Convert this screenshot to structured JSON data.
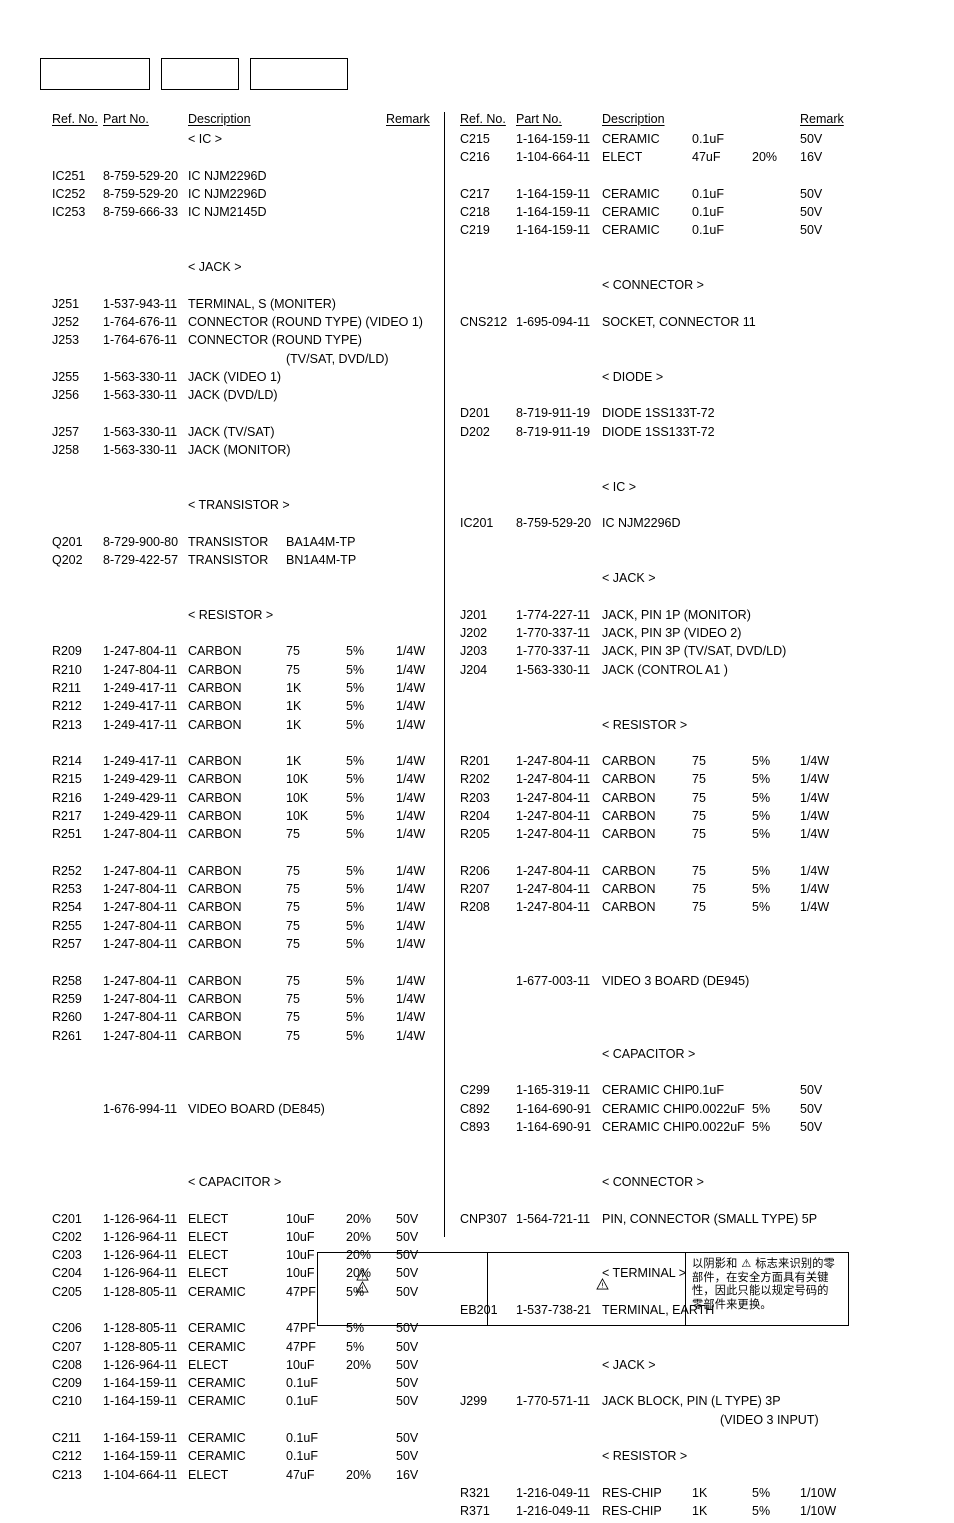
{
  "top_boxes": [
    {
      "label": ""
    },
    {
      "label": ""
    },
    {
      "label": ""
    }
  ],
  "headers": {
    "ref_no": "Ref. No.",
    "part_no": "Part No.",
    "description": "Description",
    "remark": "Remark"
  },
  "left_column": [
    {
      "kind": "section",
      "desc": "< IC >"
    },
    {
      "kind": "gap"
    },
    {
      "kind": "row",
      "ref": "IC251",
      "part": "8-759-529-20",
      "desc": "IC   NJM2296D"
    },
    {
      "kind": "row",
      "ref": "IC252",
      "part": "8-759-529-20",
      "desc": "IC   NJM2296D"
    },
    {
      "kind": "row",
      "ref": "IC253",
      "part": "8-759-666-33",
      "desc": "IC   NJM2145D"
    },
    {
      "kind": "gap2"
    },
    {
      "kind": "section",
      "desc": "< JACK >"
    },
    {
      "kind": "gap"
    },
    {
      "kind": "row",
      "ref": "J251",
      "part": "1-537-943-11",
      "desc": "TERMINAL, S (MONITER)"
    },
    {
      "kind": "row",
      "ref": "J252",
      "part": "1-764-676-11",
      "desc": "CONNECTOR (ROUND TYPE) (VIDEO 1)"
    },
    {
      "kind": "row",
      "ref": "J253",
      "part": "1-764-676-11",
      "desc": "CONNECTOR (ROUND TYPE)"
    },
    {
      "kind": "cont",
      "cont": "(TV/SAT, DVD/LD)"
    },
    {
      "kind": "row",
      "ref": "J255",
      "part": "1-563-330-11",
      "desc": "JACK (VIDEO 1)"
    },
    {
      "kind": "row",
      "ref": "J256",
      "part": "1-563-330-11",
      "desc": "JACK (DVD/LD)"
    },
    {
      "kind": "gap"
    },
    {
      "kind": "row",
      "ref": "J257",
      "part": "1-563-330-11",
      "desc": "JACK (TV/SAT)"
    },
    {
      "kind": "row",
      "ref": "J258",
      "part": "1-563-330-11",
      "desc": "JACK (MONITOR)"
    },
    {
      "kind": "gap2"
    },
    {
      "kind": "section",
      "desc": "< TRANSISTOR >"
    },
    {
      "kind": "gap"
    },
    {
      "kind": "row",
      "ref": "Q201",
      "part": "8-729-900-80",
      "desc": "TRANSISTOR",
      "val": "BA1A4M-TP"
    },
    {
      "kind": "row",
      "ref": "Q202",
      "part": "8-729-422-57",
      "desc": "TRANSISTOR",
      "val": "BN1A4M-TP"
    },
    {
      "kind": "gap2"
    },
    {
      "kind": "section",
      "desc": "< RESISTOR >"
    },
    {
      "kind": "gap"
    },
    {
      "kind": "row",
      "ref": "R209",
      "part": "1-247-804-11",
      "desc": "CARBON",
      "val": "75",
      "tol": "5%",
      "rat": "1/4W"
    },
    {
      "kind": "row",
      "ref": "R210",
      "part": "1-247-804-11",
      "desc": "CARBON",
      "val": "75",
      "tol": "5%",
      "rat": "1/4W"
    },
    {
      "kind": "row",
      "ref": "R211",
      "part": "1-249-417-11",
      "desc": "CARBON",
      "val": "1K",
      "tol": "5%",
      "rat": "1/4W"
    },
    {
      "kind": "row",
      "ref": "R212",
      "part": "1-249-417-11",
      "desc": "CARBON",
      "val": "1K",
      "tol": "5%",
      "rat": "1/4W"
    },
    {
      "kind": "row",
      "ref": "R213",
      "part": "1-249-417-11",
      "desc": "CARBON",
      "val": "1K",
      "tol": "5%",
      "rat": "1/4W"
    },
    {
      "kind": "gap"
    },
    {
      "kind": "row",
      "ref": "R214",
      "part": "1-249-417-11",
      "desc": "CARBON",
      "val": "1K",
      "tol": "5%",
      "rat": "1/4W"
    },
    {
      "kind": "row",
      "ref": "R215",
      "part": "1-249-429-11",
      "desc": "CARBON",
      "val": "10K",
      "tol": "5%",
      "rat": "1/4W"
    },
    {
      "kind": "row",
      "ref": "R216",
      "part": "1-249-429-11",
      "desc": "CARBON",
      "val": "10K",
      "tol": "5%",
      "rat": "1/4W"
    },
    {
      "kind": "row",
      "ref": "R217",
      "part": "1-249-429-11",
      "desc": "CARBON",
      "val": "10K",
      "tol": "5%",
      "rat": "1/4W"
    },
    {
      "kind": "row",
      "ref": "R251",
      "part": "1-247-804-11",
      "desc": "CARBON",
      "val": "75",
      "tol": "5%",
      "rat": "1/4W"
    },
    {
      "kind": "gap"
    },
    {
      "kind": "row",
      "ref": "R252",
      "part": "1-247-804-11",
      "desc": "CARBON",
      "val": "75",
      "tol": "5%",
      "rat": "1/4W"
    },
    {
      "kind": "row",
      "ref": "R253",
      "part": "1-247-804-11",
      "desc": "CARBON",
      "val": "75",
      "tol": "5%",
      "rat": "1/4W"
    },
    {
      "kind": "row",
      "ref": "R254",
      "part": "1-247-804-11",
      "desc": "CARBON",
      "val": "75",
      "tol": "5%",
      "rat": "1/4W"
    },
    {
      "kind": "row",
      "ref": "R255",
      "part": "1-247-804-11",
      "desc": "CARBON",
      "val": "75",
      "tol": "5%",
      "rat": "1/4W"
    },
    {
      "kind": "row",
      "ref": "R257",
      "part": "1-247-804-11",
      "desc": "CARBON",
      "val": "75",
      "tol": "5%",
      "rat": "1/4W"
    },
    {
      "kind": "gap"
    },
    {
      "kind": "row",
      "ref": "R258",
      "part": "1-247-804-11",
      "desc": "CARBON",
      "val": "75",
      "tol": "5%",
      "rat": "1/4W"
    },
    {
      "kind": "row",
      "ref": "R259",
      "part": "1-247-804-11",
      "desc": "CARBON",
      "val": "75",
      "tol": "5%",
      "rat": "1/4W"
    },
    {
      "kind": "row",
      "ref": "R260",
      "part": "1-247-804-11",
      "desc": "CARBON",
      "val": "75",
      "tol": "5%",
      "rat": "1/4W"
    },
    {
      "kind": "row",
      "ref": "R261",
      "part": "1-247-804-11",
      "desc": "CARBON",
      "val": "75",
      "tol": "5%",
      "rat": "1/4W"
    },
    {
      "kind": "gap2"
    },
    {
      "kind": "gap"
    },
    {
      "kind": "row",
      "ref": "",
      "part": "1-676-994-11",
      "desc": "VIDEO BOARD (DE845)"
    },
    {
      "kind": "gap2"
    },
    {
      "kind": "gap"
    },
    {
      "kind": "section",
      "desc": "< CAPACITOR >"
    },
    {
      "kind": "gap"
    },
    {
      "kind": "row",
      "ref": "C201",
      "part": "1-126-964-11",
      "desc": "ELECT",
      "val": "10uF",
      "tol": "20%",
      "rat": "50V"
    },
    {
      "kind": "row",
      "ref": "C202",
      "part": "1-126-964-11",
      "desc": "ELECT",
      "val": "10uF",
      "tol": "20%",
      "rat": "50V"
    },
    {
      "kind": "row",
      "ref": "C203",
      "part": "1-126-964-11",
      "desc": "ELECT",
      "val": "10uF",
      "tol": "20%",
      "rat": "50V"
    },
    {
      "kind": "row",
      "ref": "C204",
      "part": "1-126-964-11",
      "desc": "ELECT",
      "val": "10uF",
      "tol": "20%",
      "rat": "50V"
    },
    {
      "kind": "row",
      "ref": "C205",
      "part": "1-128-805-11",
      "desc": "CERAMIC",
      "val": "47PF",
      "tol": "5%",
      "rat": "50V"
    },
    {
      "kind": "gap"
    },
    {
      "kind": "row",
      "ref": "C206",
      "part": "1-128-805-11",
      "desc": "CERAMIC",
      "val": "47PF",
      "tol": "5%",
      "rat": "50V"
    },
    {
      "kind": "row",
      "ref": "C207",
      "part": "1-128-805-11",
      "desc": "CERAMIC",
      "val": "47PF",
      "tol": "5%",
      "rat": "50V"
    },
    {
      "kind": "row",
      "ref": "C208",
      "part": "1-126-964-11",
      "desc": "ELECT",
      "val": "10uF",
      "tol": "20%",
      "rat": "50V"
    },
    {
      "kind": "row",
      "ref": "C209",
      "part": "1-164-159-11",
      "desc": "CERAMIC",
      "val": "0.1uF",
      "tol": "",
      "rat": "50V"
    },
    {
      "kind": "row",
      "ref": "C210",
      "part": "1-164-159-11",
      "desc": "CERAMIC",
      "val": "0.1uF",
      "tol": "",
      "rat": "50V"
    },
    {
      "kind": "gap"
    },
    {
      "kind": "row",
      "ref": "C211",
      "part": "1-164-159-11",
      "desc": "CERAMIC",
      "val": "0.1uF",
      "tol": "",
      "rat": "50V"
    },
    {
      "kind": "row",
      "ref": "C212",
      "part": "1-164-159-11",
      "desc": "CERAMIC",
      "val": "0.1uF",
      "tol": "",
      "rat": "50V"
    },
    {
      "kind": "row",
      "ref": "C213",
      "part": "1-104-664-11",
      "desc": "ELECT",
      "val": "47uF",
      "tol": "20%",
      "rat": "16V"
    }
  ],
  "right_column": [
    {
      "kind": "row",
      "ref": "C215",
      "part": "1-164-159-11",
      "desc": "CERAMIC",
      "val": "0.1uF",
      "tol": "",
      "rat": "50V"
    },
    {
      "kind": "row",
      "ref": "C216",
      "part": "1-104-664-11",
      "desc": "ELECT",
      "val": "47uF",
      "tol": "20%",
      "rat": "16V"
    },
    {
      "kind": "gap"
    },
    {
      "kind": "row",
      "ref": "C217",
      "part": "1-164-159-11",
      "desc": "CERAMIC",
      "val": "0.1uF",
      "tol": "",
      "rat": "50V"
    },
    {
      "kind": "row",
      "ref": "C218",
      "part": "1-164-159-11",
      "desc": "CERAMIC",
      "val": "0.1uF",
      "tol": "",
      "rat": "50V"
    },
    {
      "kind": "row",
      "ref": "C219",
      "part": "1-164-159-11",
      "desc": "CERAMIC",
      "val": "0.1uF",
      "tol": "",
      "rat": "50V"
    },
    {
      "kind": "gap2"
    },
    {
      "kind": "section",
      "desc": "< CONNECTOR >"
    },
    {
      "kind": "gap"
    },
    {
      "kind": "row",
      "ref": "CNS212",
      "part": "1-695-094-11",
      "desc": "SOCKET, CONNECTOR 11"
    },
    {
      "kind": "gap2"
    },
    {
      "kind": "section",
      "desc": "< DIODE >"
    },
    {
      "kind": "gap"
    },
    {
      "kind": "row",
      "ref": "D201",
      "part": "8-719-911-19",
      "desc": "DIODE   1SS133T-72"
    },
    {
      "kind": "row",
      "ref": "D202",
      "part": "8-719-911-19",
      "desc": "DIODE   1SS133T-72"
    },
    {
      "kind": "gap2"
    },
    {
      "kind": "section",
      "desc": "< IC >"
    },
    {
      "kind": "gap"
    },
    {
      "kind": "row",
      "ref": "IC201",
      "part": "8-759-529-20",
      "desc": "IC   NJM2296D"
    },
    {
      "kind": "gap2"
    },
    {
      "kind": "section",
      "desc": "< JACK >"
    },
    {
      "kind": "gap"
    },
    {
      "kind": "row",
      "ref": "J201",
      "part": "1-774-227-11",
      "desc": "JACK, PIN 1P (MONITOR)"
    },
    {
      "kind": "row",
      "ref": "J202",
      "part": "1-770-337-11",
      "desc": "JACK, PIN 3P (VIDEO 2)"
    },
    {
      "kind": "row",
      "ref": "J203",
      "part": "1-770-337-11",
      "desc": "JACK, PIN 3P (TV/SAT, DVD/LD)"
    },
    {
      "kind": "row",
      "ref": "J204",
      "part": "1-563-330-11",
      "desc": "JACK (CONTROL A1  )"
    },
    {
      "kind": "gap2"
    },
    {
      "kind": "section",
      "desc": "< RESISTOR >"
    },
    {
      "kind": "gap"
    },
    {
      "kind": "row",
      "ref": "R201",
      "part": "1-247-804-11",
      "desc": "CARBON",
      "val": "75",
      "tol": "5%",
      "rat": "1/4W"
    },
    {
      "kind": "row",
      "ref": "R202",
      "part": "1-247-804-11",
      "desc": "CARBON",
      "val": "75",
      "tol": "5%",
      "rat": "1/4W"
    },
    {
      "kind": "row",
      "ref": "R203",
      "part": "1-247-804-11",
      "desc": "CARBON",
      "val": "75",
      "tol": "5%",
      "rat": "1/4W"
    },
    {
      "kind": "row",
      "ref": "R204",
      "part": "1-247-804-11",
      "desc": "CARBON",
      "val": "75",
      "tol": "5%",
      "rat": "1/4W"
    },
    {
      "kind": "row",
      "ref": "R205",
      "part": "1-247-804-11",
      "desc": "CARBON",
      "val": "75",
      "tol": "5%",
      "rat": "1/4W"
    },
    {
      "kind": "gap"
    },
    {
      "kind": "row",
      "ref": "R206",
      "part": "1-247-804-11",
      "desc": "CARBON",
      "val": "75",
      "tol": "5%",
      "rat": "1/4W"
    },
    {
      "kind": "row",
      "ref": "R207",
      "part": "1-247-804-11",
      "desc": "CARBON",
      "val": "75",
      "tol": "5%",
      "rat": "1/4W"
    },
    {
      "kind": "row",
      "ref": "R208",
      "part": "1-247-804-11",
      "desc": "CARBON",
      "val": "75",
      "tol": "5%",
      "rat": "1/4W"
    },
    {
      "kind": "gap2"
    },
    {
      "kind": "gap"
    },
    {
      "kind": "row",
      "ref": "",
      "part": "1-677-003-11",
      "desc": "VIDEO 3 BOARD (DE945)"
    },
    {
      "kind": "gap2"
    },
    {
      "kind": "gap"
    },
    {
      "kind": "section",
      "desc": "< CAPACITOR >"
    },
    {
      "kind": "gap"
    },
    {
      "kind": "row",
      "ref": "C299",
      "part": "1-165-319-11",
      "desc": "CERAMIC CHIP",
      "val": "0.1uF",
      "tol": "",
      "rat": "50V"
    },
    {
      "kind": "row",
      "ref": "C892",
      "part": "1-164-690-91",
      "desc": "CERAMIC CHIP",
      "val": "0.0022uF",
      "tol": "5%",
      "rat": "50V"
    },
    {
      "kind": "row",
      "ref": "C893",
      "part": "1-164-690-91",
      "desc": "CERAMIC CHIP",
      "val": "0.0022uF",
      "tol": "5%",
      "rat": "50V"
    },
    {
      "kind": "gap2"
    },
    {
      "kind": "section",
      "desc": "< CONNECTOR >"
    },
    {
      "kind": "gap"
    },
    {
      "kind": "row",
      "ref": "CNP307",
      "part": "1-564-721-11",
      "desc": "PIN, CONNECTOR (SMALL TYPE) 5P"
    },
    {
      "kind": "gap2"
    },
    {
      "kind": "section",
      "desc": "< TERMINAL >"
    },
    {
      "kind": "gap"
    },
    {
      "kind": "row",
      "ref": "EB201",
      "part": "1-537-738-21",
      "desc": "TERMINAL, EARTH"
    },
    {
      "kind": "gap2"
    },
    {
      "kind": "section",
      "desc": "< JACK >"
    },
    {
      "kind": "gap"
    },
    {
      "kind": "row",
      "ref": "J299",
      "part": "1-770-571-11",
      "desc": "JACK BLOCK, PIN (L TYPE) 3P"
    },
    {
      "kind": "cont",
      "cont": "(VIDEO 3 INPUT)"
    },
    {
      "kind": "gap"
    },
    {
      "kind": "section",
      "desc": "< RESISTOR >"
    },
    {
      "kind": "gap"
    },
    {
      "kind": "row",
      "ref": "R321",
      "part": "1-216-049-11",
      "desc": "RES-CHIP",
      "val": "1K",
      "tol": "5%",
      "rat": "1/10W"
    },
    {
      "kind": "row",
      "ref": "R371",
      "part": "1-216-049-11",
      "desc": "RES-CHIP",
      "val": "1K",
      "tol": "5%",
      "rat": "1/10W"
    }
  ],
  "footer": {
    "cell1_icons": [
      "warning-triangle",
      "warning-triangle"
    ],
    "cell2_icons": [
      "warning-triangle"
    ],
    "note_lines": [
      "以阴影和 ⚠ 标志来识别的零",
      "部件，在安全方面具有关键",
      "性，因此只能以规定号码的",
      "零部件来更换。"
    ]
  }
}
